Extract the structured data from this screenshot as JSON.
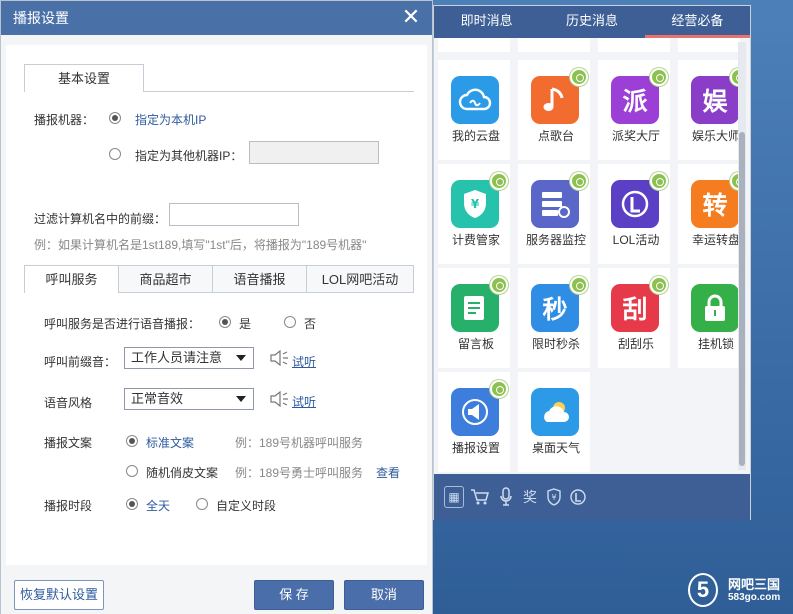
{
  "dialog": {
    "title": "播报设置",
    "tab_basic": "基本设置",
    "machine_label": "播报机器：",
    "machine_opt_local": "指定为本机IP",
    "machine_opt_other": "指定为其他机器IP：",
    "machine_other_ip": "",
    "filter_label": "过滤计算机名中的前缀：",
    "filter_value": "",
    "filter_hint": "例：如果计算机名是1st189,填写\"1st\"后，将播报为\"189号机器\"",
    "sub_tabs": [
      "呼叫服务",
      "商品超市",
      "语音播报",
      "LOL网吧活动"
    ],
    "voice_label": "呼叫服务是否进行语音播报：",
    "voice_yes": "是",
    "voice_no": "否",
    "prefix_label": "呼叫前缀音：",
    "prefix_value": "工作人员请注意",
    "style_label": "语音风格",
    "style_value": "正常音效",
    "listen": "试听",
    "copy_label": "播报文案",
    "copy_std": "标准文案",
    "copy_std_example": "例：189号机器呼叫服务",
    "copy_random": "随机俏皮文案",
    "copy_random_example": "例：189号勇士呼叫服务",
    "copy_view": "查看",
    "period_label": "播报时段",
    "period_allday": "全天",
    "period_custom": "自定义时段",
    "btn_restore": "恢复默认设置",
    "btn_save": "保 存",
    "btn_cancel": "取消"
  },
  "apps": {
    "tabs": [
      "即时消息",
      "历史消息",
      "经营必备"
    ],
    "active_tab": "经营必备",
    "items": [
      {
        "label": "我的云盘",
        "icon": "cloud-icon",
        "color": "#2b9be8"
      },
      {
        "label": "点歌台",
        "icon": "music-note-icon",
        "color": "#f26b2f"
      },
      {
        "label": "派奖大厅",
        "icon": "award-char-icon",
        "color": "#9b3fd6"
      },
      {
        "label": "娱乐大师",
        "icon": "entertainment-char-icon",
        "color": "#8a3ec8"
      },
      {
        "label": "计费管家",
        "icon": "shield-yen-icon",
        "color": "#26c2ac"
      },
      {
        "label": "服务器监控",
        "icon": "server-icon",
        "color": "#5a67c9"
      },
      {
        "label": "LOL活动",
        "icon": "lol-logo-icon",
        "color": "#5b3fc4"
      },
      {
        "label": "幸运转盘",
        "icon": "spin-char-icon",
        "color": "#f57d1f"
      },
      {
        "label": "留言板",
        "icon": "notepad-icon",
        "color": "#27b06a"
      },
      {
        "label": "限时秒杀",
        "icon": "flash-sale-char-icon",
        "color": "#2f8de4"
      },
      {
        "label": "刮刮乐",
        "icon": "scratch-char-icon",
        "color": "#e6394a"
      },
      {
        "label": "挂机锁",
        "icon": "lock-icon",
        "color": "#35b048"
      },
      {
        "label": "播报设置",
        "icon": "megaphone-icon",
        "color": "#3d7ddc"
      },
      {
        "label": "桌面天气",
        "icon": "weather-icon",
        "color": "#2c9ae6"
      }
    ],
    "bottom_icons": [
      "billing-icon",
      "cart-icon",
      "mic-icon",
      "award-icon",
      "shield-yen-icon",
      "lol-icon"
    ]
  },
  "watermark": {
    "logo": "5",
    "line1": "网吧三国",
    "line2": "583go.com"
  }
}
